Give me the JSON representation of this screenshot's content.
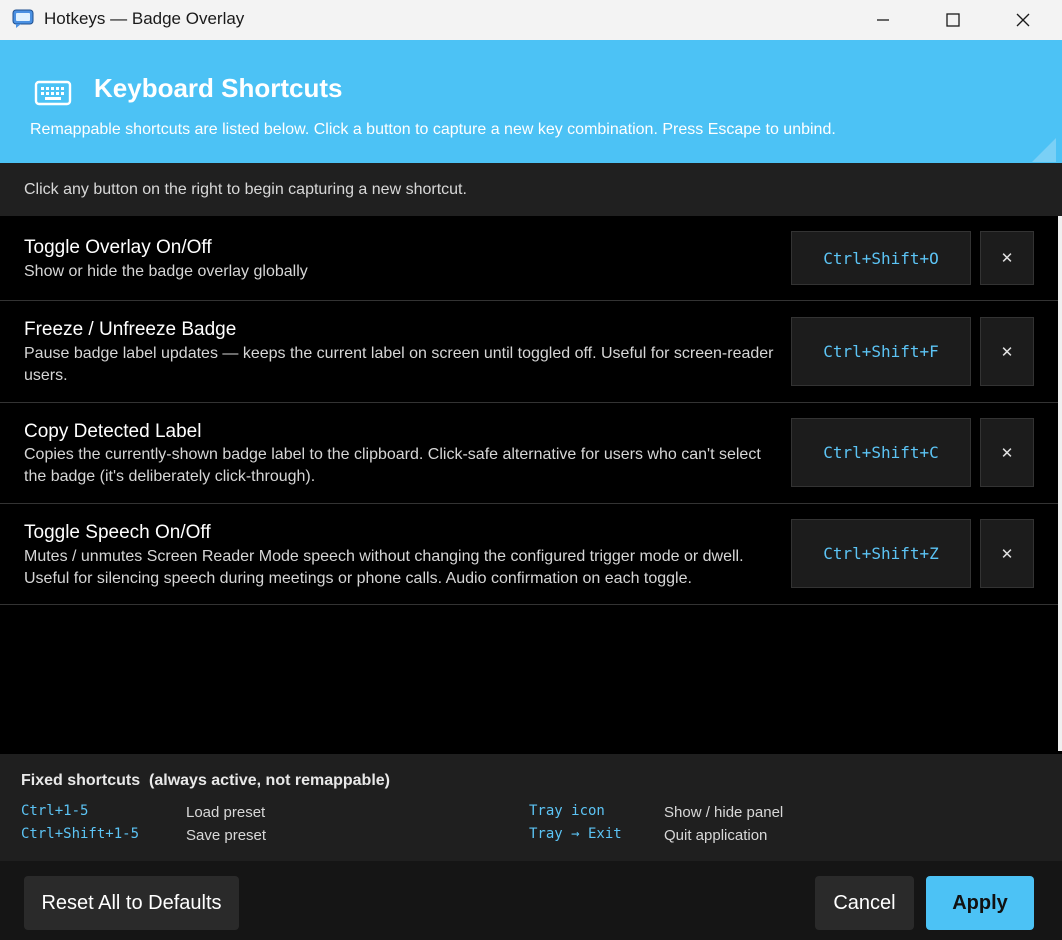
{
  "window": {
    "title": "Hotkeys — Badge Overlay",
    "icon": "chat-bubble-app-icon"
  },
  "window_controls": {
    "minimize_icon": "minimize-icon",
    "maximize_icon": "maximize-icon",
    "close_icon": "close-icon"
  },
  "header": {
    "icon": "keyboard-icon",
    "title": "Keyboard Shortcuts",
    "subtitle": "Remappable shortcuts are listed below. Click a button to capture a new key combination. Press Escape to unbind."
  },
  "hint": "Click any button on the right to begin capturing a new shortcut.",
  "shortcuts": [
    {
      "name": "Toggle Overlay On/Off",
      "description": "Show or hide the badge overlay globally",
      "key": "Ctrl+Shift+O",
      "clear_label": "✕"
    },
    {
      "name": "Freeze / Unfreeze Badge",
      "description": "Pause badge label updates — keeps the current label on screen until toggled off. Useful for screen-reader users.",
      "key": "Ctrl+Shift+F",
      "clear_label": "✕"
    },
    {
      "name": "Copy Detected Label",
      "description": "Copies the currently-shown badge label to the clipboard. Click-safe alternative for users who can't select the badge (it's deliberately click-through).",
      "key": "Ctrl+Shift+C",
      "clear_label": "✕"
    },
    {
      "name": "Toggle Speech On/Off",
      "description": "Mutes / unmutes Screen Reader Mode speech without changing the configured trigger mode or dwell. Useful for silencing speech during meetings or phone calls. Audio confirmation on each toggle.",
      "key": "Ctrl+Shift+Z",
      "clear_label": "✕"
    }
  ],
  "fixed": {
    "title": "Fixed shortcuts  (always active, not remappable)",
    "items": [
      {
        "key": "Ctrl+1-5",
        "desc": "Load preset"
      },
      {
        "key": "Ctrl+Shift+1-5",
        "desc": "Save preset"
      },
      {
        "key": "Tray icon",
        "desc": "Show / hide panel"
      },
      {
        "key": "Tray → Exit",
        "desc": "Quit application"
      }
    ]
  },
  "footer": {
    "reset_label": "Reset All to Defaults",
    "cancel_label": "Cancel",
    "apply_label": "Apply"
  },
  "colors": {
    "accent": "#4cc2f5",
    "key_text": "#5cc4f5",
    "background": "#000000",
    "panel": "#1f1f1f"
  }
}
